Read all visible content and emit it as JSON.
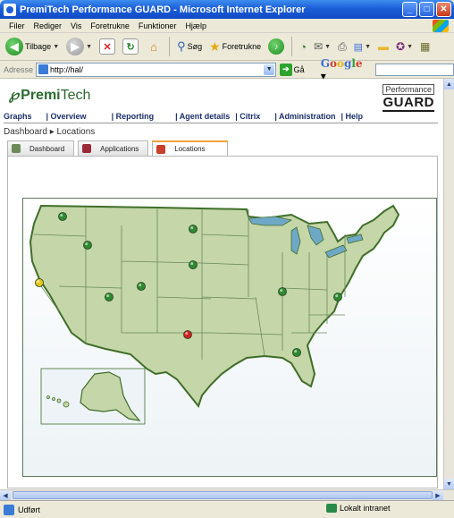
{
  "window": {
    "title": "PremiTech Performance GUARD - Microsoft Internet Explorer"
  },
  "menu": [
    "Filer",
    "Rediger",
    "Vis",
    "Foretrukne",
    "Funktioner",
    "Hjælp"
  ],
  "toolbar": {
    "back_label": "Tilbage",
    "search_label": "Søg",
    "favorites_label": "Foretrukne"
  },
  "address": {
    "label": "Adresse",
    "value": "http://hal/",
    "go_label": "Gå",
    "google": "Google"
  },
  "app": {
    "logo_bold": "Premi",
    "logo_light": "Tech",
    "brand_top": "Performance",
    "brand_bottom": "GUARD",
    "nav": [
      "Graphs",
      "| Overview",
      "| Reporting",
      "| Agent details",
      "| Citrix",
      "| Administration",
      "| Help"
    ],
    "breadcrumb": "Dashboard ▸ Locations",
    "tabs": [
      {
        "label": "Dashboard",
        "active": false,
        "icon": "dashboard-icon",
        "color": "#6a8a5a"
      },
      {
        "label": "Applications",
        "active": false,
        "icon": "applications-icon",
        "color": "#9a2a3a"
      },
      {
        "label": "Locations",
        "active": true,
        "icon": "locations-icon",
        "color": "#c8402a"
      }
    ]
  },
  "map": {
    "land_color": "#c5d6a8",
    "border_color": "#3f6e2a",
    "lake_color": "#6fa8c7",
    "markers": [
      {
        "status": "ok",
        "color": "#2f8a2f"
      },
      {
        "status": "ok",
        "color": "#2f8a2f"
      },
      {
        "status": "ok",
        "color": "#2f8a2f"
      },
      {
        "status": "ok",
        "color": "#2f8a2f"
      },
      {
        "status": "warning",
        "color": "#e8c41a"
      },
      {
        "status": "ok",
        "color": "#2f8a2f"
      },
      {
        "status": "ok",
        "color": "#2f8a2f"
      },
      {
        "status": "ok",
        "color": "#2f8a2f"
      },
      {
        "status": "ok",
        "color": "#2f8a2f"
      },
      {
        "status": "critical",
        "color": "#d42020"
      },
      {
        "status": "ok",
        "color": "#2f8a2f"
      }
    ]
  },
  "status": {
    "left": "Udført",
    "zone": "Lokalt intranet"
  }
}
